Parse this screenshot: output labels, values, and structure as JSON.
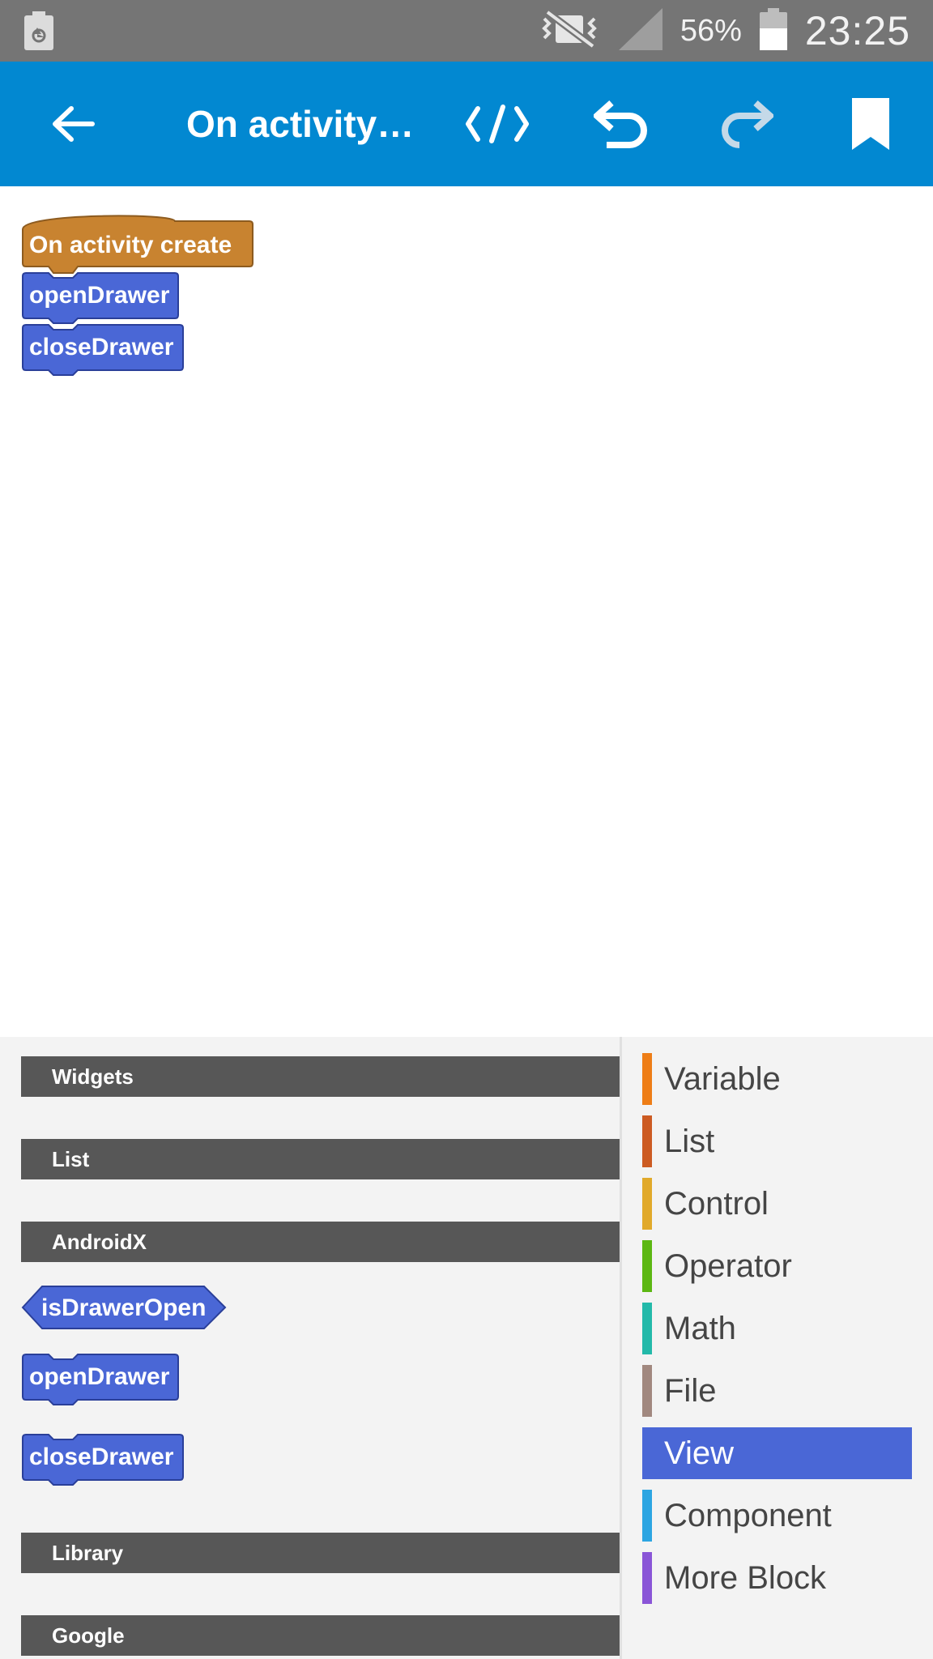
{
  "status_bar": {
    "left_icon": "recycle-battery-icon",
    "icons": [
      "vibrate-mute-icon",
      "signal-icon",
      "battery-icon"
    ],
    "battery_percent": "56%",
    "time": "23:25"
  },
  "app_bar": {
    "title": "On activity…",
    "icons": [
      "back-arrow-icon",
      "code-icon",
      "undo-icon",
      "redo-icon",
      "bookmark-icon"
    ],
    "color": "#0288d1"
  },
  "canvas": {
    "event_block": "On activity create",
    "blocks": [
      "openDrawer",
      "closeDrawer"
    ],
    "event_color": "#c88330",
    "block_color": "#4a67d6",
    "fab_icon": "puzzle-piece-icon"
  },
  "palette": {
    "sections": {
      "widgets": "Widgets",
      "list": "List",
      "androidx": "AndroidX",
      "library": "Library",
      "google": "Google"
    },
    "androidx_blocks": {
      "is_drawer_open": "isDrawerOpen",
      "open_drawer": "openDrawer",
      "close_drawer": "closeDrawer"
    },
    "categories": [
      {
        "label": "Variable",
        "color": "#ee7d16"
      },
      {
        "label": "List",
        "color": "#cc5b22"
      },
      {
        "label": "Control",
        "color": "#e1a92a"
      },
      {
        "label": "Operator",
        "color": "#5cb712"
      },
      {
        "label": "Math",
        "color": "#23b9a9"
      },
      {
        "label": "File",
        "color": "#a1887f"
      },
      {
        "label": "View",
        "color": "#4a67d6",
        "selected": true
      },
      {
        "label": "Component",
        "color": "#2ca5e2"
      },
      {
        "label": "More Block",
        "color": "#8a55d7"
      }
    ]
  }
}
